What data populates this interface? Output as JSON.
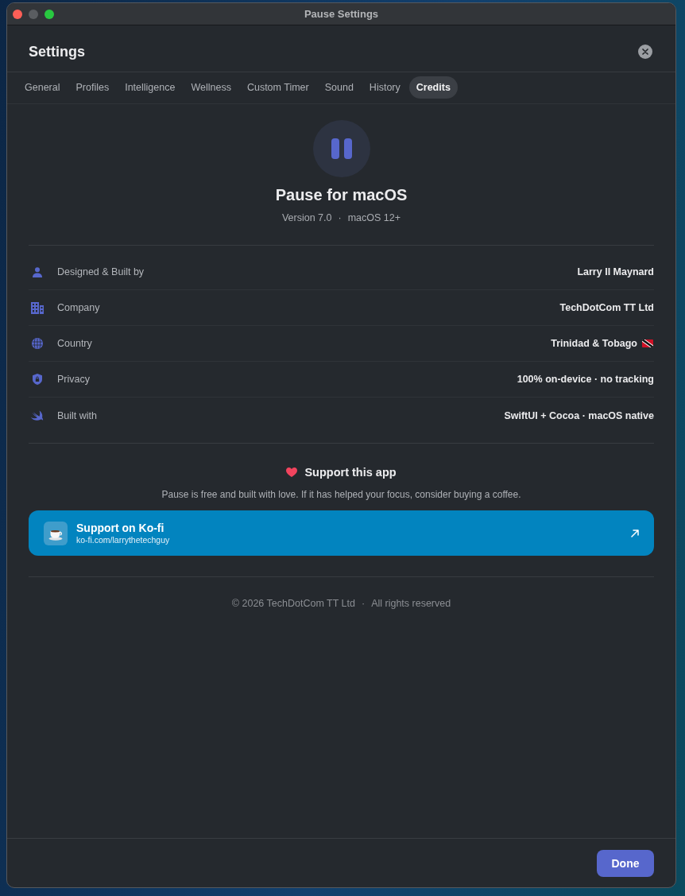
{
  "window": {
    "title": "Pause Settings",
    "traffic_lights": [
      {
        "kind": "close",
        "disabled": false
      },
      {
        "kind": "minimize",
        "disabled": true
      },
      {
        "kind": "zoom",
        "disabled": false
      }
    ]
  },
  "header": {
    "title": "Settings"
  },
  "tabs": [
    {
      "label": "General",
      "selected": false
    },
    {
      "label": "Profiles",
      "selected": false
    },
    {
      "label": "Intelligence",
      "selected": false
    },
    {
      "label": "Wellness",
      "selected": false
    },
    {
      "label": "Custom Timer",
      "selected": false
    },
    {
      "label": "Sound",
      "selected": false
    },
    {
      "label": "History",
      "selected": false
    },
    {
      "label": "Credits",
      "selected": true
    }
  ],
  "app": {
    "name": "Pause for macOS",
    "version": "Version 7.0",
    "separator": "·",
    "platform": "macOS 12+"
  },
  "details": [
    {
      "kind": "designer",
      "label": "Designed & Built by",
      "value": "Larry II Maynard"
    },
    {
      "kind": "company",
      "label": "Company",
      "value": "TechDotCom TT Ltd"
    },
    {
      "kind": "country",
      "label": "Country",
      "value": "Trinidad & Tobago"
    },
    {
      "kind": "privacy",
      "label": "Privacy",
      "value": "100% on-device · no tracking"
    },
    {
      "kind": "stack",
      "label": "Built with",
      "value": "SwiftUI + Cocoa · macOS native"
    }
  ],
  "support": {
    "title": "Support this app",
    "description": "Pause is free and built with love. If it has helped your focus, consider buying a coffee.",
    "link": {
      "title": "Support on Ko-fi",
      "url": "ko-fi.com/larrythetechguy"
    }
  },
  "footer": {
    "copyright": "© 2026 TechDotCom TT Ltd",
    "separator": "·",
    "rights": "All rights reserved"
  },
  "buttons": [
    {
      "label": "Done"
    }
  ]
}
